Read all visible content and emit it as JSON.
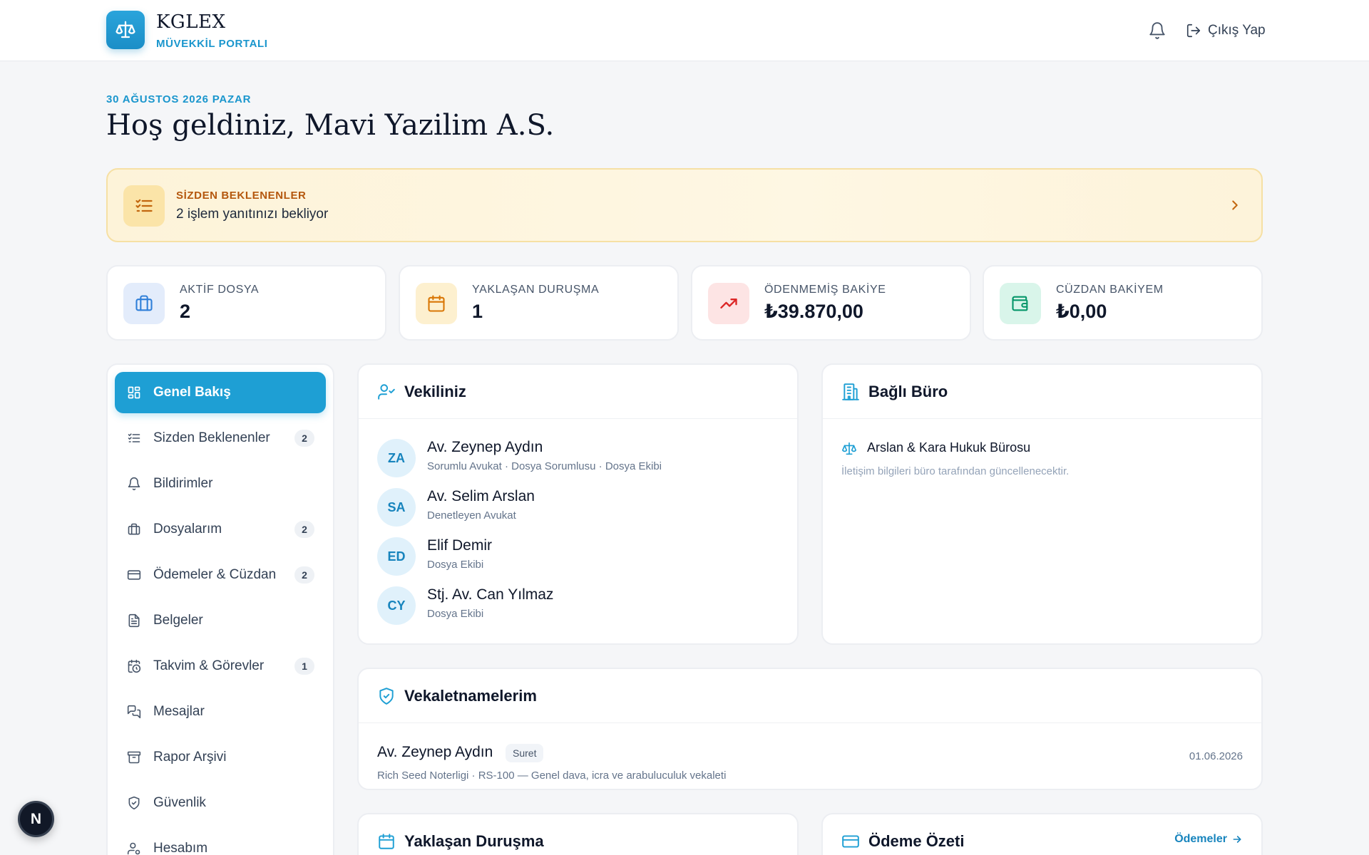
{
  "brand": {
    "name": "KGLEX",
    "subtitle": "MÜVEKKİL PORTALI"
  },
  "header": {
    "logout_label": "Çıkış Yap"
  },
  "greeting": {
    "date": "30 AĞUSTOS 2026 PAZAR",
    "welcome": "Hoş geldiniz, Mavi Yazilim A.S."
  },
  "pending": {
    "title": "SİZDEN BEKLENENLER",
    "text": "2 işlem yanıtınızı bekliyor"
  },
  "stats": [
    {
      "label": "AKTİF DOSYA",
      "value": "2",
      "icon": "briefcase-icon",
      "color": "#2f7fd9",
      "bg": "#e3ecfb"
    },
    {
      "label": "YAKLAŞAN DURUŞMA",
      "value": "1",
      "icon": "calendar-icon",
      "color": "#d97706",
      "bg": "#fdf0cf"
    },
    {
      "label": "ÖDENMEMİŞ BAKİYE",
      "value": "₺39.870,00",
      "icon": "trending-up-icon",
      "color": "#dc2626",
      "bg": "#fde4e4"
    },
    {
      "label": "CÜZDAN BAKİYEM",
      "value": "₺0,00",
      "icon": "wallet-icon",
      "color": "#059669",
      "bg": "#d9f5ea"
    }
  ],
  "sidebar": {
    "items": [
      {
        "label": "Genel Bakış",
        "icon": "grid-icon",
        "active": true
      },
      {
        "label": "Sizden Beklenenler",
        "icon": "list-check-icon",
        "badge": "2"
      },
      {
        "label": "Bildirimler",
        "icon": "bell-icon"
      },
      {
        "label": "Dosyalarım",
        "icon": "briefcase-icon",
        "badge": "2"
      },
      {
        "label": "Ödemeler & Cüzdan",
        "icon": "credit-card-icon",
        "badge": "2"
      },
      {
        "label": "Belgeler",
        "icon": "document-icon"
      },
      {
        "label": "Takvim & Görevler",
        "icon": "calendar-clock-icon",
        "badge": "1"
      },
      {
        "label": "Mesajlar",
        "icon": "messages-icon"
      },
      {
        "label": "Rapor Arşivi",
        "icon": "archive-icon"
      },
      {
        "label": "Güvenlik",
        "icon": "shield-icon"
      },
      {
        "label": "Hesabım",
        "icon": "user-icon"
      }
    ]
  },
  "representatives": {
    "title": "Vekiliniz",
    "people": [
      {
        "initials": "ZA",
        "name": "Av. Zeynep Aydın",
        "role": "Sorumlu Avukat · Dosya Sorumlusu · Dosya Ekibi"
      },
      {
        "initials": "SA",
        "name": "Av. Selim Arslan",
        "role": "Denetleyen Avukat"
      },
      {
        "initials": "ED",
        "name": "Elif Demir",
        "role": "Dosya Ekibi"
      },
      {
        "initials": "CY",
        "name": "Stj. Av. Can Yılmaz",
        "role": "Dosya Ekibi"
      }
    ]
  },
  "bureau": {
    "title": "Bağlı Büro",
    "name": "Arslan & Kara Hukuk Bürosu",
    "note": "İletişim bilgileri büro tarafından güncellenecektir."
  },
  "powers": {
    "title": "Vekaletnamelerim",
    "item": {
      "name": "Av. Zeynep Aydın",
      "badge": "Suret",
      "detail": "Rich Seed Noterligi · RS-100 — Genel dava, icra ve arabuluculuk vekaleti",
      "date": "01.06.2026"
    }
  },
  "hearing": {
    "title": "Yaklaşan Duruşma"
  },
  "payment_summary": {
    "title": "Ödeme Özeti",
    "link": "Ödemeler"
  },
  "fab": {
    "label": "N"
  },
  "colors": {
    "accent": "#1e9fd4",
    "warning_bg": "#fdf3d9",
    "warning_text": "#b4570d"
  }
}
